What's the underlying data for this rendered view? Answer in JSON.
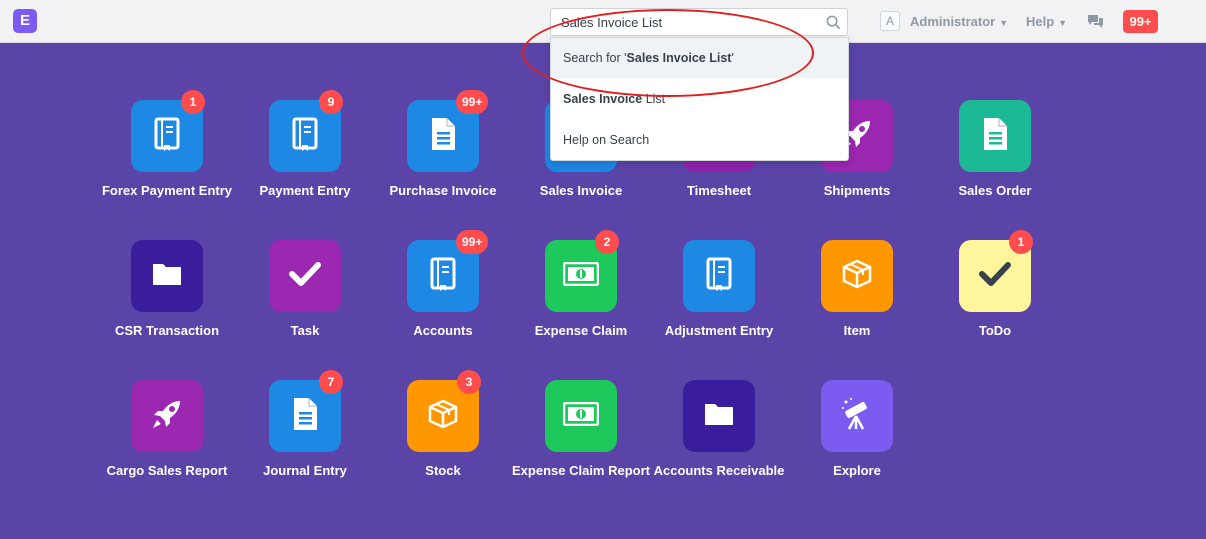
{
  "navbar": {
    "logo_letter": "E",
    "search_value": "Sales Invoice List",
    "user_avatar": "A",
    "user_label": "Administrator",
    "help_label": "Help",
    "notifications": "99+",
    "icons": [
      "search-icon",
      "chat-icon",
      "chevron-down-icon"
    ]
  },
  "search_dropdown": {
    "item1_prefix": "Search for '",
    "item1_bold": "Sales Invoice List",
    "item1_suffix": "'",
    "item2_bold": "Sales Invoice",
    "item2_rest": " List",
    "item3": "Help on Search"
  },
  "modules": [
    {
      "label": "Forex Payment Entry",
      "badge": "1",
      "color": "#1e88e5",
      "icon": "book-icon"
    },
    {
      "label": "Payment Entry",
      "badge": "9",
      "color": "#1e88e5",
      "icon": "book-icon"
    },
    {
      "label": "Purchase Invoice",
      "badge": "99+",
      "color": "#1e88e5",
      "icon": "document-icon"
    },
    {
      "label": "Sales Invoice",
      "badge": "",
      "color": "#1e88e5",
      "icon": "document-icon"
    },
    {
      "label": "Timesheet",
      "badge": "",
      "color": "#8e24aa",
      "icon": "clock-icon"
    },
    {
      "label": "Shipments",
      "badge": "",
      "color": "#9c27b0",
      "icon": "rocket-icon"
    },
    {
      "label": "Sales Order",
      "badge": "",
      "color": "#1cb996",
      "icon": "document-icon"
    },
    {
      "label": "CSR Transaction",
      "badge": "",
      "color": "#3a1d9c",
      "icon": "folder-icon"
    },
    {
      "label": "Task",
      "badge": "",
      "color": "#9c27b0",
      "icon": "check-icon"
    },
    {
      "label": "Accounts",
      "badge": "99+",
      "color": "#1e88e5",
      "icon": "book-icon"
    },
    {
      "label": "Expense Claim",
      "badge": "2",
      "color": "#1ec95c",
      "icon": "money-icon"
    },
    {
      "label": "Adjustment Entry",
      "badge": "",
      "color": "#1e88e5",
      "icon": "book-icon"
    },
    {
      "label": "Item",
      "badge": "",
      "color": "#ff9800",
      "icon": "box-icon"
    },
    {
      "label": "ToDo",
      "badge": "1",
      "color": "#fff59d",
      "icon": "check-icon"
    },
    {
      "label": "Cargo Sales Report",
      "badge": "",
      "color": "#9c27b0",
      "icon": "rocket-icon"
    },
    {
      "label": "Journal Entry",
      "badge": "7",
      "color": "#1e88e5",
      "icon": "document-icon"
    },
    {
      "label": "Stock",
      "badge": "3",
      "color": "#ff9800",
      "icon": "box-icon"
    },
    {
      "label": "Expense Claim Report",
      "badge": "",
      "color": "#1ec95c",
      "icon": "money-icon"
    },
    {
      "label": "Accounts Receivable",
      "badge": "",
      "color": "#3a1d9c",
      "icon": "folder-icon"
    },
    {
      "label": "Explore",
      "badge": "",
      "color": "#7c5cf0",
      "icon": "telescope-icon"
    }
  ]
}
